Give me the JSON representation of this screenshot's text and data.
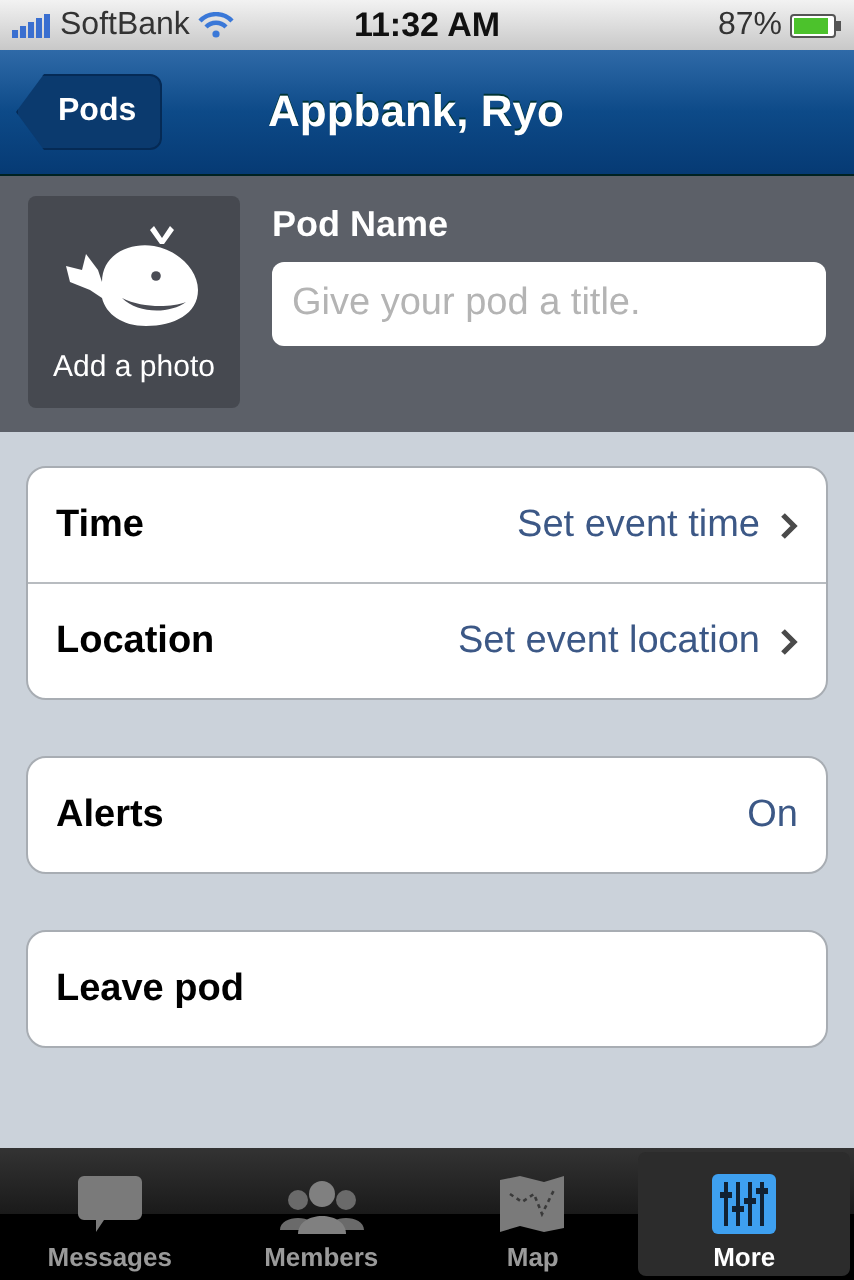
{
  "status_bar": {
    "carrier": "SoftBank",
    "time": "11:32 AM",
    "battery": "87%"
  },
  "nav_bar": {
    "back": "Pods",
    "title": "Appbank, Ryo"
  },
  "header": {
    "photo_label": "Add a photo",
    "name_label": "Pod Name",
    "name_field": {
      "placeholder": "Give your pod a title."
    }
  },
  "groups": [
    {
      "rows": [
        {
          "kind": "disclosure",
          "label": "Time",
          "value": "Set event time"
        },
        {
          "kind": "disclosure",
          "label": "Location",
          "value": "Set event location"
        }
      ]
    },
    {
      "rows": [
        {
          "kind": "value",
          "label": "Alerts",
          "value": "On"
        }
      ]
    },
    {
      "rows": [
        {
          "kind": "plain",
          "label": "Leave pod"
        }
      ]
    }
  ],
  "tab_bar": [
    {
      "label": "Messages",
      "selected": false
    },
    {
      "label": "Members",
      "selected": false
    },
    {
      "label": "Map",
      "selected": false
    },
    {
      "label": "More",
      "selected": true
    }
  ]
}
